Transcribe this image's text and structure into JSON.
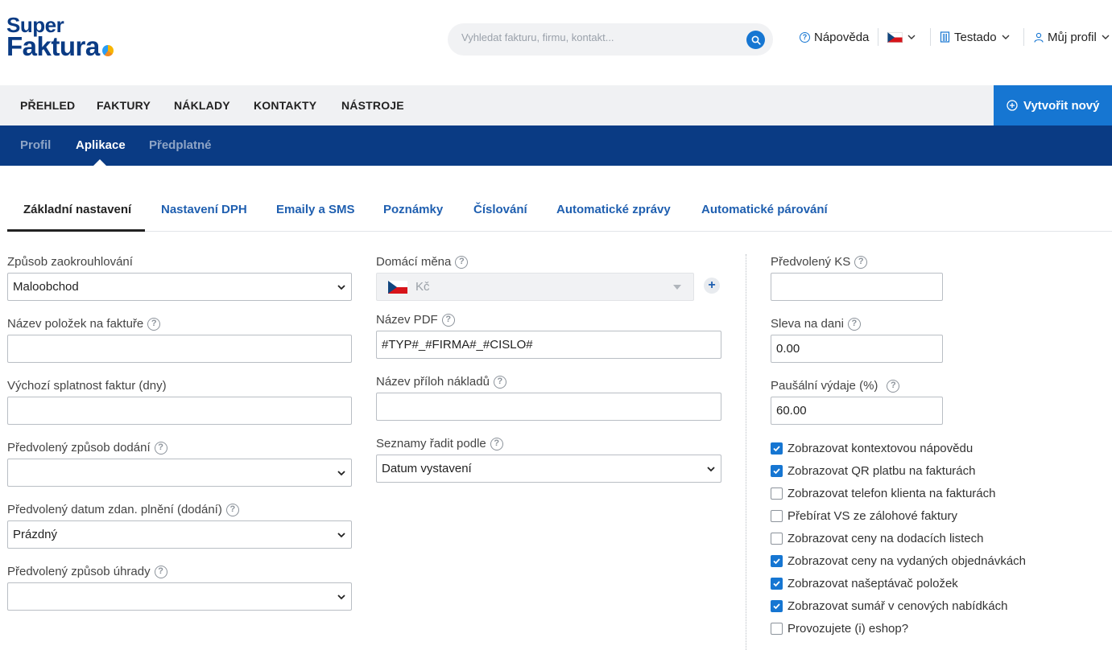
{
  "brand": {
    "line1": "Super",
    "line2": "Faktura"
  },
  "search": {
    "placeholder": "Vyhledat fakturu, firmu, kontakt..."
  },
  "topbar": {
    "help": "Nápověda",
    "company": "Testado",
    "profile": "Můj profil"
  },
  "main_nav": {
    "items": [
      "PŘEHLED",
      "FAKTURY",
      "NÁKLADY",
      "KONTAKTY",
      "NÁSTROJE"
    ],
    "create": "Vytvořit nový"
  },
  "sub_nav": {
    "items": [
      "Profil",
      "Aplikace",
      "Předplatné"
    ],
    "active": "Aplikace"
  },
  "tabs": {
    "items": [
      "Základní nastavení",
      "Nastavení DPH",
      "Emaily a SMS",
      "Poznámky",
      "Číslování",
      "Automatické zprávy",
      "Automatické párování"
    ],
    "active": "Základní nastavení"
  },
  "form": {
    "rounding": {
      "label": "Způsob zaokrouhlování",
      "value": "Maloobchod"
    },
    "items_name": {
      "label": "Název položek na faktuře",
      "value": ""
    },
    "due": {
      "label": "Výchozí splatnost faktur (dny)",
      "value": ""
    },
    "delivery": {
      "label": "Předvolený způsob dodání",
      "value": ""
    },
    "tax_date": {
      "label": "Předvolený datum zdan. plnění (dodání)",
      "value": "Prázdný"
    },
    "payment": {
      "label": "Předvolený způsob úhrady",
      "value": ""
    },
    "currency": {
      "label": "Domácí měna",
      "value": "Kč"
    },
    "pdf_name": {
      "label": "Název PDF",
      "value": "#TYP#_#FIRMA#_#CISLO#"
    },
    "attach_name": {
      "label": "Název příloh nákladů",
      "value": ""
    },
    "sort": {
      "label": "Seznamy řadit podle",
      "value": "Datum vystavení"
    },
    "ks": {
      "label": "Předvolený KS",
      "value": ""
    },
    "tax_discount": {
      "label": "Sleva na dani",
      "value": "0.00"
    },
    "flat_expenses": {
      "label": "Paušální výdaje (%)",
      "value": "60.00"
    }
  },
  "checkboxes": [
    {
      "label": "Zobrazovat kontextovou nápovědu",
      "checked": true
    },
    {
      "label": "Zobrazovat QR platbu na fakturách",
      "checked": true
    },
    {
      "label": "Zobrazovat telefon klienta na fakturách",
      "checked": false
    },
    {
      "label": "Přebírat VS ze zálohové faktury",
      "checked": false
    },
    {
      "label": "Zobrazovat ceny na dodacích listech",
      "checked": false
    },
    {
      "label": "Zobrazovat ceny na vydaných objednávkách",
      "checked": true
    },
    {
      "label": "Zobrazovat našeptávač položek",
      "checked": true
    },
    {
      "label": "Zobrazovat sumář v cenových nabídkách",
      "checked": true
    },
    {
      "label": "Provozujete (i) eshop?",
      "checked": false
    }
  ],
  "colors": {
    "brand_blue": "#0a3b84",
    "accent": "#1676d2",
    "link": "#1f5fb0"
  },
  "icons": {
    "search": "search-icon",
    "help": "question-circle-icon",
    "flag": "czech-flag-icon",
    "company": "building-icon",
    "profile": "user-icon",
    "create": "plus-circle-icon"
  }
}
